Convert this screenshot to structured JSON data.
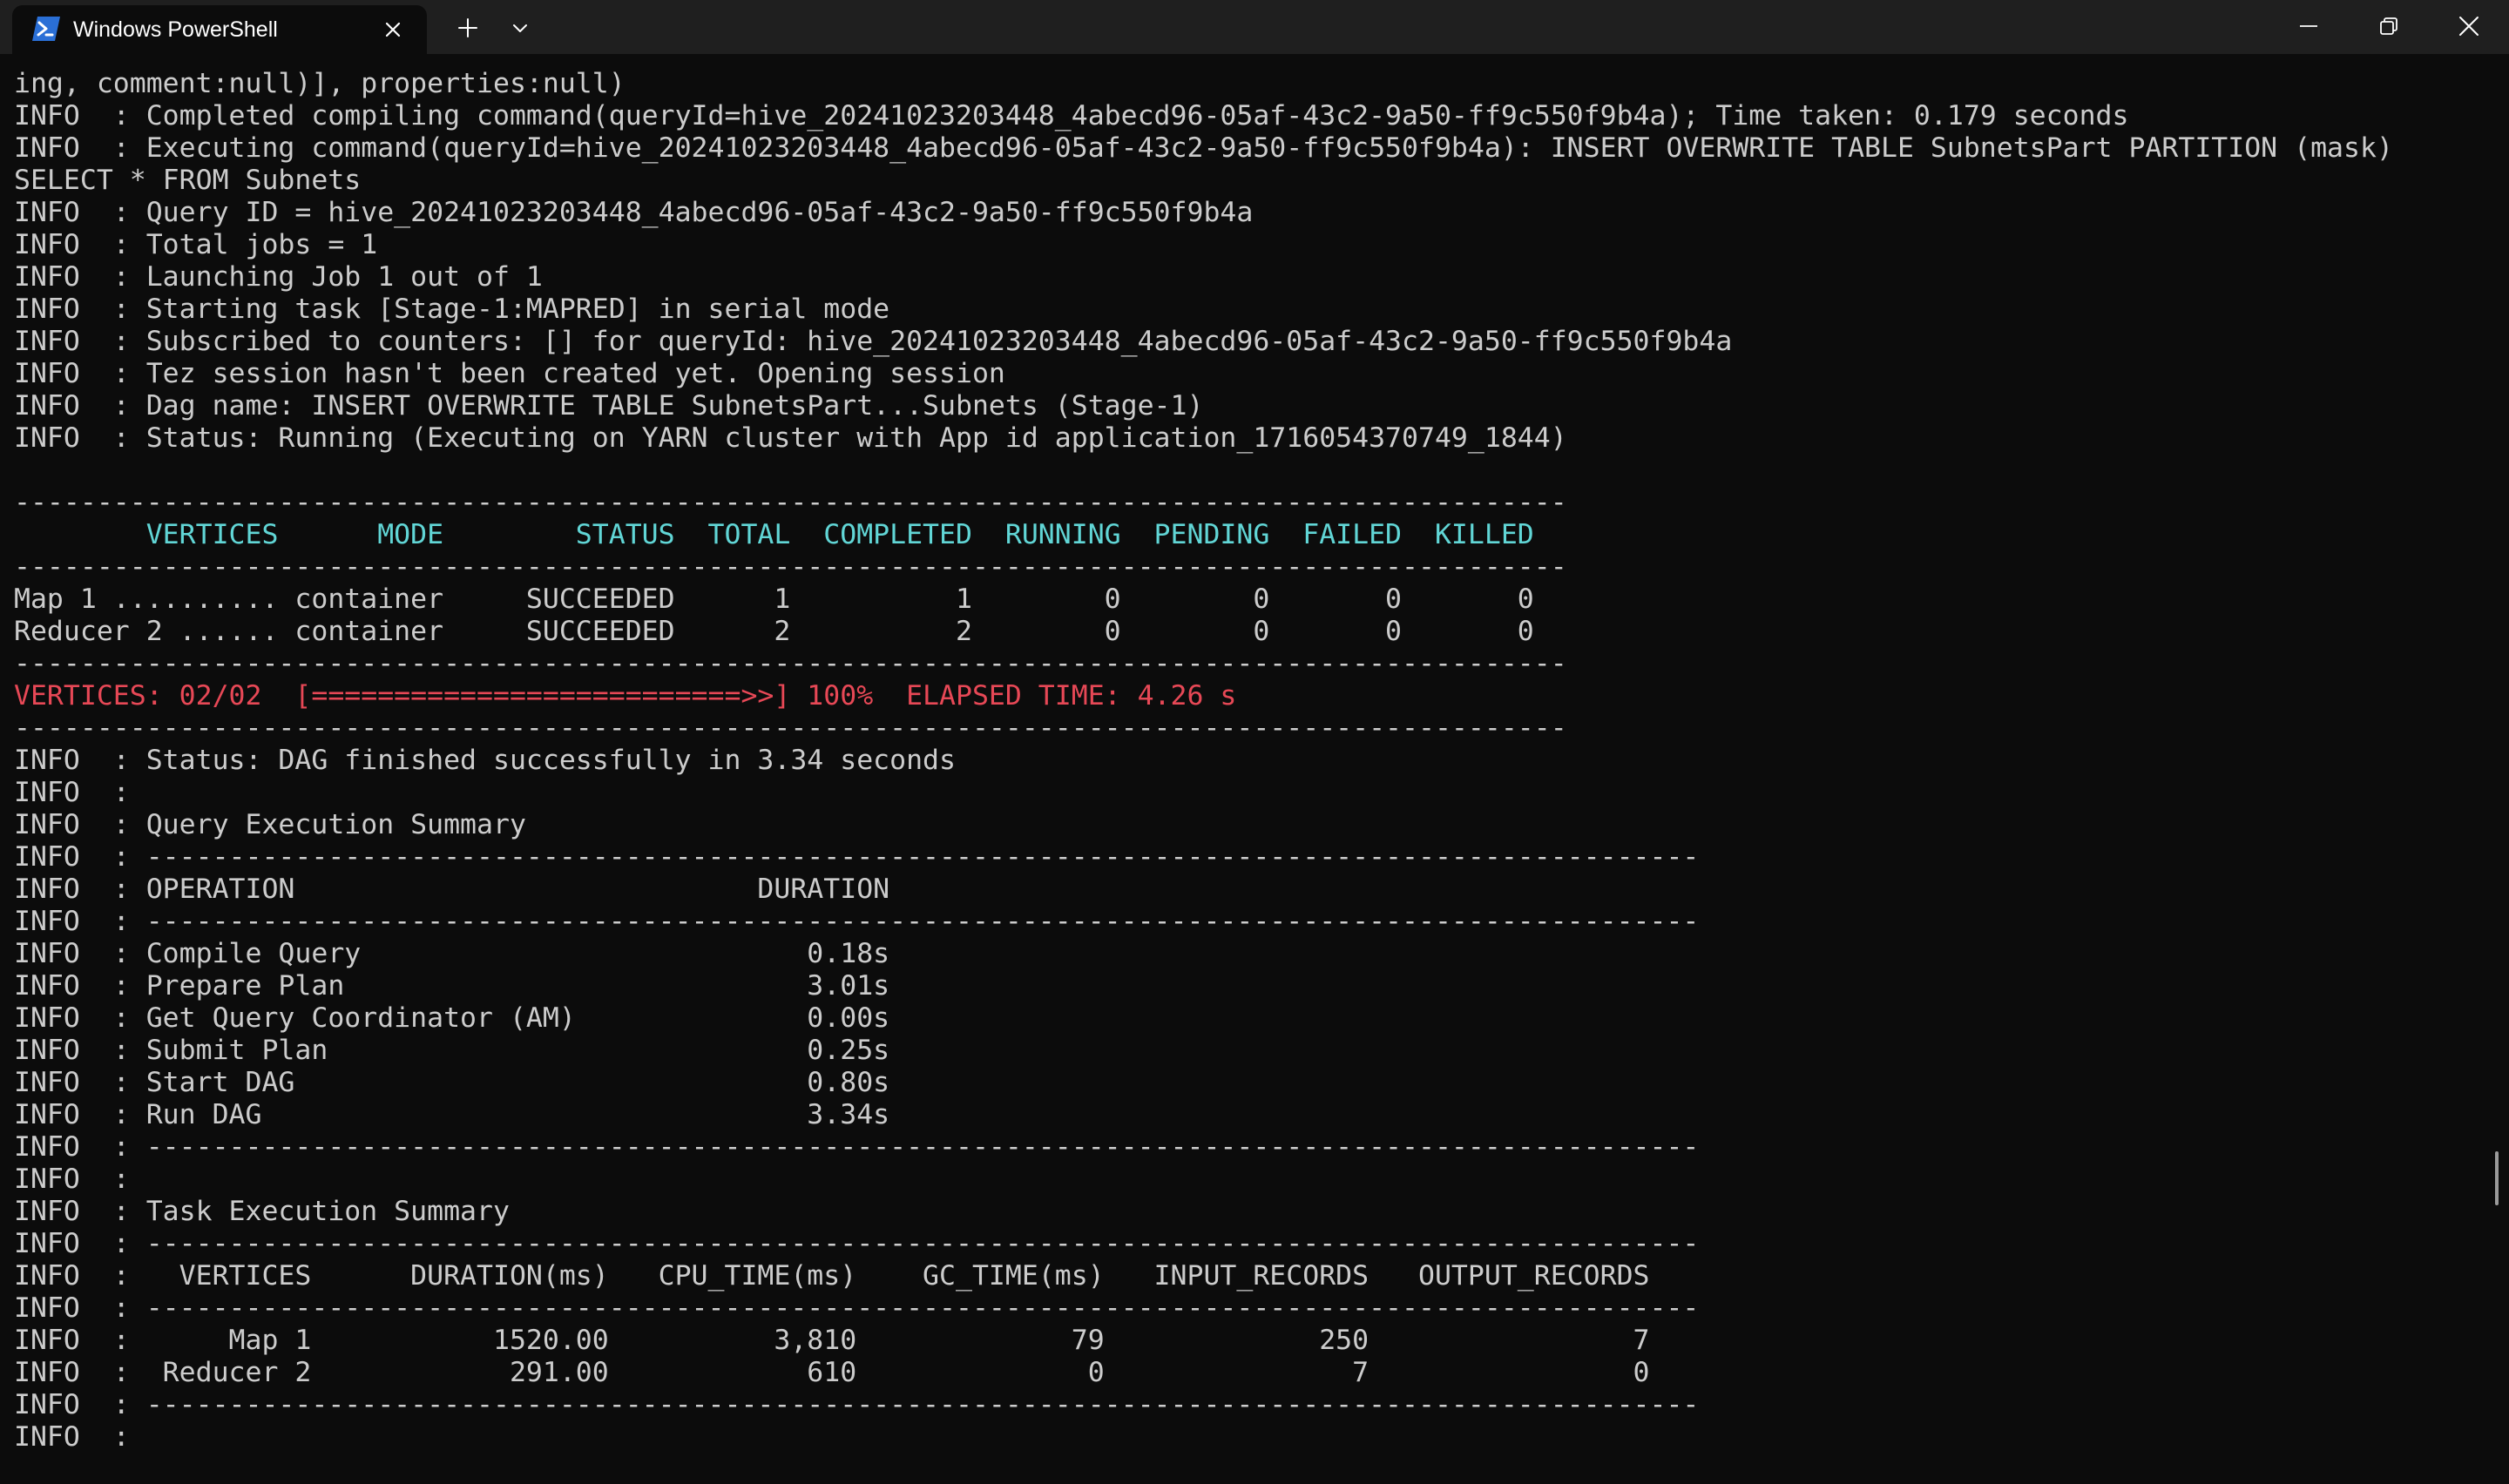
{
  "window": {
    "tab_title": "Windows PowerShell",
    "icons": {
      "tab": "powershell-icon",
      "close_tab": "close-icon",
      "new_tab": "plus-icon",
      "dropdown": "chevron-down-icon",
      "minimize": "minimize-icon",
      "restore": "restore-icon",
      "close_window": "close-icon"
    },
    "colors": {
      "titlebar": "#1f1f1f",
      "background": "#0c0c0c",
      "text": "#cccccc",
      "header_cyan": "#61d6d6",
      "progress_red": "#e74856"
    }
  },
  "terminal": {
    "lines": [
      "ing, comment:null)], properties:null)",
      "INFO  : Completed compiling command(queryId=hive_20241023203448_4abecd96-05af-43c2-9a50-ff9c550f9b4a); Time taken: 0.179 seconds",
      "INFO  : Executing command(queryId=hive_20241023203448_4abecd96-05af-43c2-9a50-ff9c550f9b4a): INSERT OVERWRITE TABLE SubnetsPart PARTITION (mask)",
      "SELECT * FROM Subnets",
      "INFO  : Query ID = hive_20241023203448_4abecd96-05af-43c2-9a50-ff9c550f9b4a",
      "INFO  : Total jobs = 1",
      "INFO  : Launching Job 1 out of 1",
      "INFO  : Starting task [Stage-1:MAPRED] in serial mode",
      "INFO  : Subscribed to counters: [] for queryId: hive_20241023203448_4abecd96-05af-43c2-9a50-ff9c550f9b4a",
      "INFO  : Tez session hasn't been created yet. Opening session",
      "INFO  : Dag name: INSERT OVERWRITE TABLE SubnetsPart...Subnets (Stage-1)",
      "INFO  : Status: Running (Executing on YARN cluster with App id application_1716054370749_1844)",
      "",
      "----------------------------------------------------------------------------------------------",
      "        VERTICES      MODE        STATUS  TOTAL  COMPLETED  RUNNING  PENDING  FAILED  KILLED",
      "----------------------------------------------------------------------------------------------",
      "Map 1 .......... container     SUCCEEDED      1          1        0        0       0       0",
      "Reducer 2 ...... container     SUCCEEDED      2          2        0        0       0       0",
      "----------------------------------------------------------------------------------------------",
      "VERTICES: 02/02  [==========================>>] 100%  ELAPSED TIME: 4.26 s",
      "----------------------------------------------------------------------------------------------",
      "INFO  : Status: DAG finished successfully in 3.34 seconds",
      "INFO  :",
      "INFO  : Query Execution Summary",
      "INFO  : ----------------------------------------------------------------------------------------------",
      "INFO  : OPERATION                            DURATION",
      "INFO  : ----------------------------------------------------------------------------------------------",
      "INFO  : Compile Query                           0.18s",
      "INFO  : Prepare Plan                            3.01s",
      "INFO  : Get Query Coordinator (AM)              0.00s",
      "INFO  : Submit Plan                             0.25s",
      "INFO  : Start DAG                               0.80s",
      "INFO  : Run DAG                                 3.34s",
      "INFO  : ----------------------------------------------------------------------------------------------",
      "INFO  :",
      "INFO  : Task Execution Summary",
      "INFO  : ----------------------------------------------------------------------------------------------",
      "INFO  :   VERTICES      DURATION(ms)   CPU_TIME(ms)    GC_TIME(ms)   INPUT_RECORDS   OUTPUT_RECORDS",
      "INFO  : ----------------------------------------------------------------------------------------------",
      "INFO  :      Map 1           1520.00          3,810             79             250                7",
      "INFO  :  Reducer 2            291.00            610              0               7                0",
      "INFO  : ----------------------------------------------------------------------------------------------",
      "INFO  :"
    ]
  }
}
